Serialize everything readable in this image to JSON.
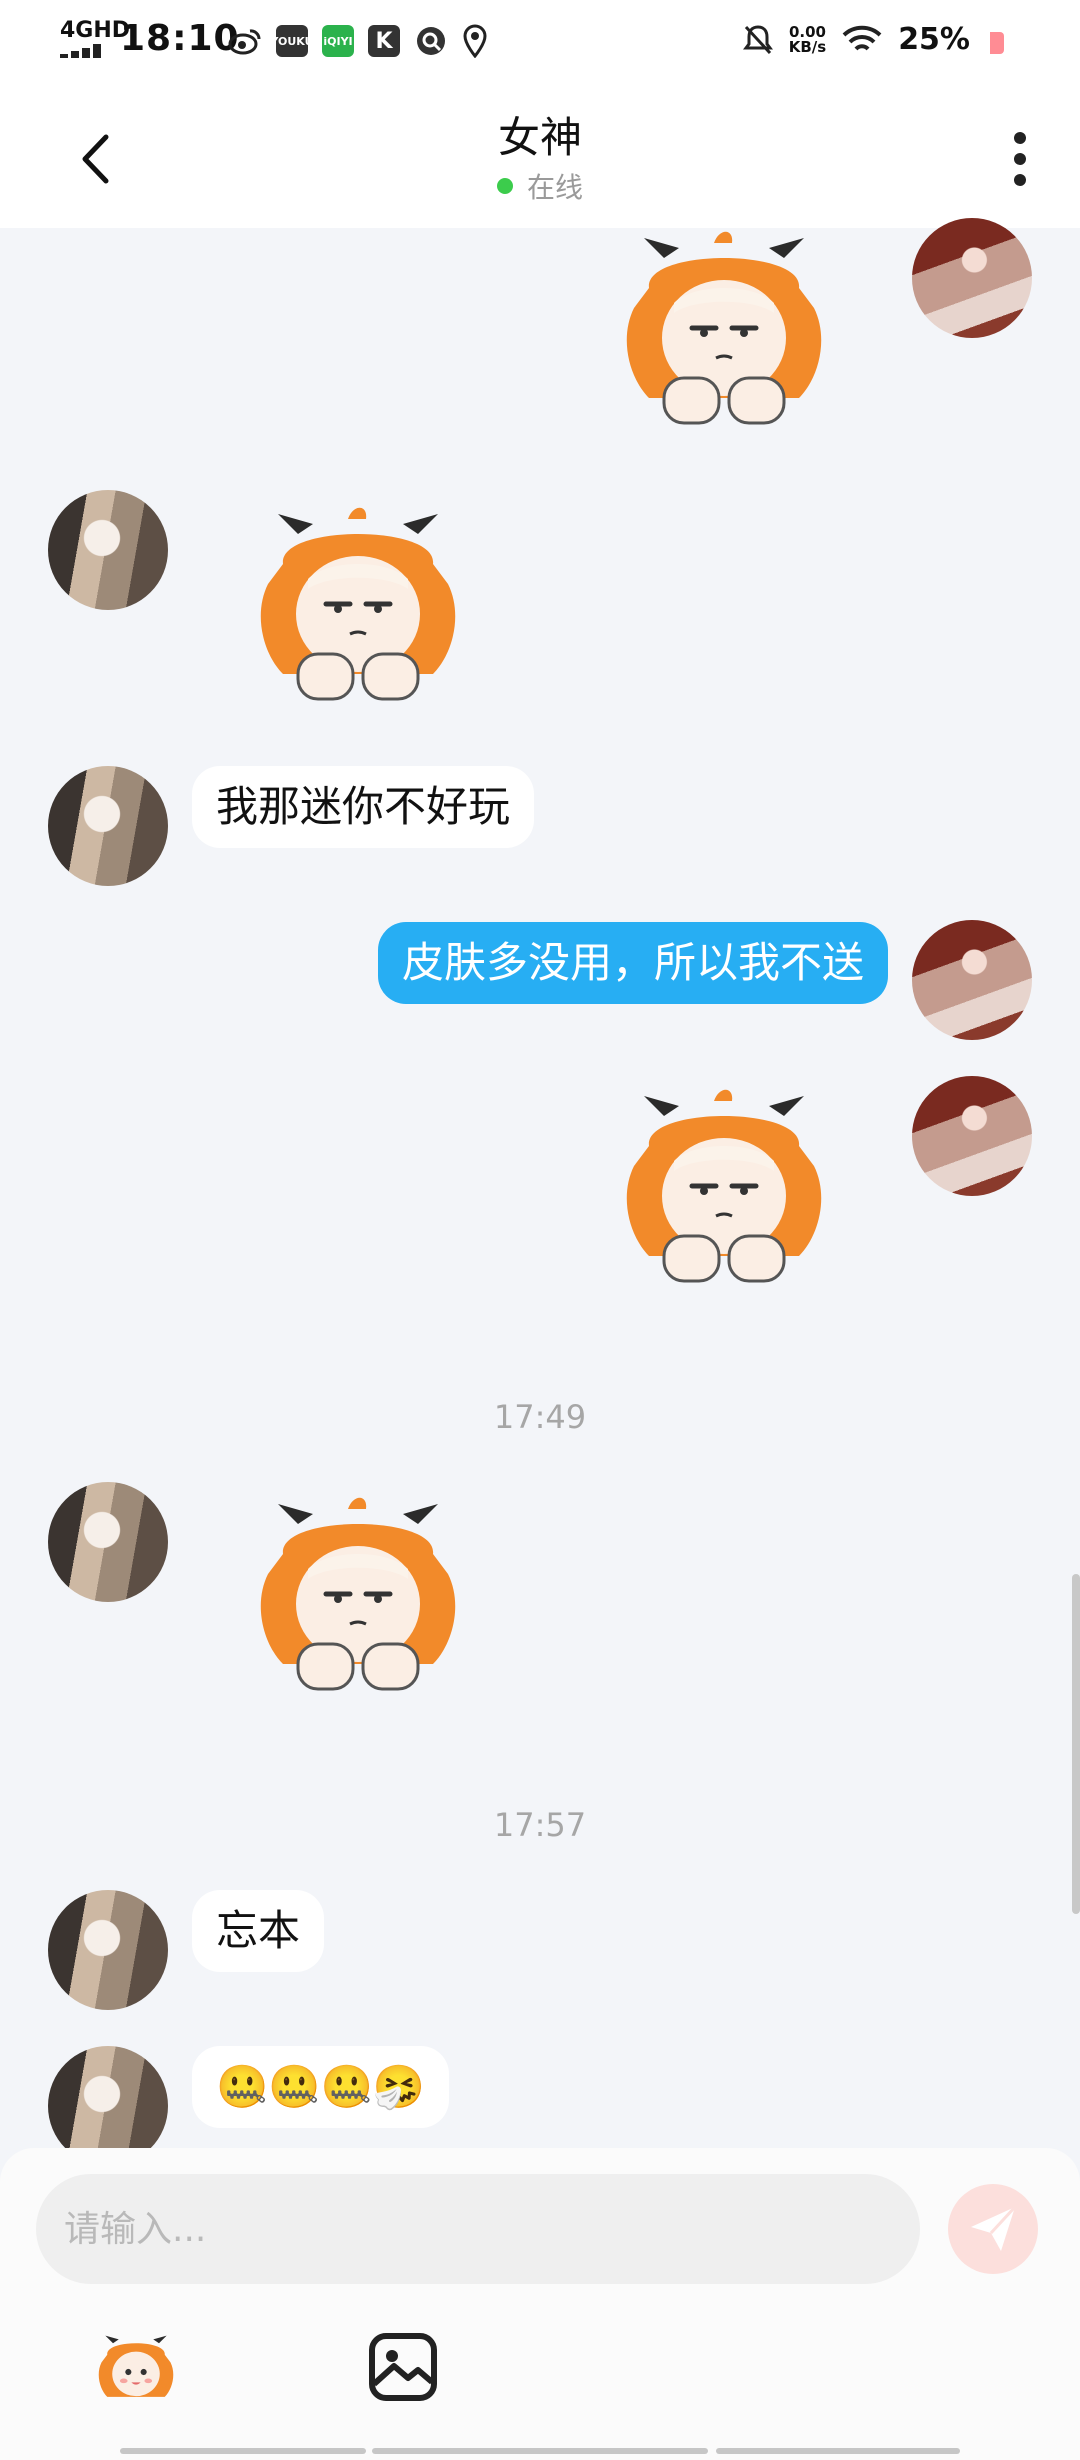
{
  "status_bar": {
    "network": "4GHD",
    "time": "18:10",
    "apps": [
      "YOUKU",
      "iQIYI",
      "K"
    ],
    "speed_value": "0.00",
    "speed_unit": "KB/s",
    "battery": "25%"
  },
  "header": {
    "title": "女神",
    "status": "在线",
    "status_color": "#3ccc4c"
  },
  "messages": {
    "m3": "我那迷你不好玩",
    "m4": "皮肤多没用，所以我不送",
    "t1": "17:49",
    "t2": "17:57",
    "m7": "忘本",
    "m8": "🤐🤐🤐🤧"
  },
  "composer": {
    "placeholder": "请输入...",
    "send_color": "#fcdfdc"
  },
  "colors": {
    "outgoing_bubble": "#27aef3",
    "background": "#f3f5f9"
  }
}
